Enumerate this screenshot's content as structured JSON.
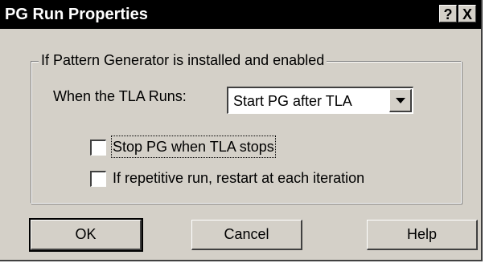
{
  "window": {
    "title": "PG Run Properties",
    "help_button": "?",
    "close_button": "X"
  },
  "group": {
    "legend": "If Pattern Generator is installed and enabled",
    "when_label": "When the TLA Runs:",
    "combo": {
      "value": "Start PG after TLA"
    },
    "checkboxes": [
      {
        "label": "Stop PG when TLA stops",
        "checked": false
      },
      {
        "label": "If repetitive run, restart at each iteration",
        "checked": false
      }
    ]
  },
  "buttons": {
    "ok": "OK",
    "cancel": "Cancel",
    "help": "Help"
  },
  "colors": {
    "dialog_face": "#d4d0c8",
    "title_bar": "#000000",
    "title_text": "#ffffff"
  }
}
